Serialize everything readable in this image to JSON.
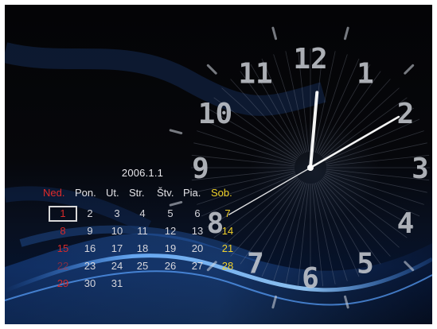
{
  "calendar": {
    "date_label": "2006.1.1",
    "weekdays": [
      "Ned.",
      "Pon.",
      "Ut.",
      "Str.",
      "Štv.",
      "Pia.",
      "Sob."
    ],
    "weeks": [
      [
        "1",
        "2",
        "3",
        "4",
        "5",
        "6",
        "7"
      ],
      [
        "8",
        "9",
        "10",
        "11",
        "12",
        "13",
        "14"
      ],
      [
        "15",
        "16",
        "17",
        "18",
        "19",
        "20",
        "21"
      ],
      [
        "22",
        "23",
        "24",
        "25",
        "26",
        "27",
        "28"
      ],
      [
        "29",
        "30",
        "31",
        "",
        "",
        "",
        ""
      ]
    ],
    "selected_day": "1"
  },
  "clock": {
    "numerals": [
      "12",
      "1",
      "2",
      "3",
      "4",
      "5",
      "6",
      "7",
      "8",
      "9",
      "10",
      "11"
    ],
    "hour": 12,
    "minute": 10,
    "second": 40
  },
  "colors": {
    "sunday": "#e02a2a",
    "saturday": "#f1d32a",
    "text": "#e4e4e8",
    "numeral": "#c9ccd2",
    "hand": "#ffffff"
  }
}
